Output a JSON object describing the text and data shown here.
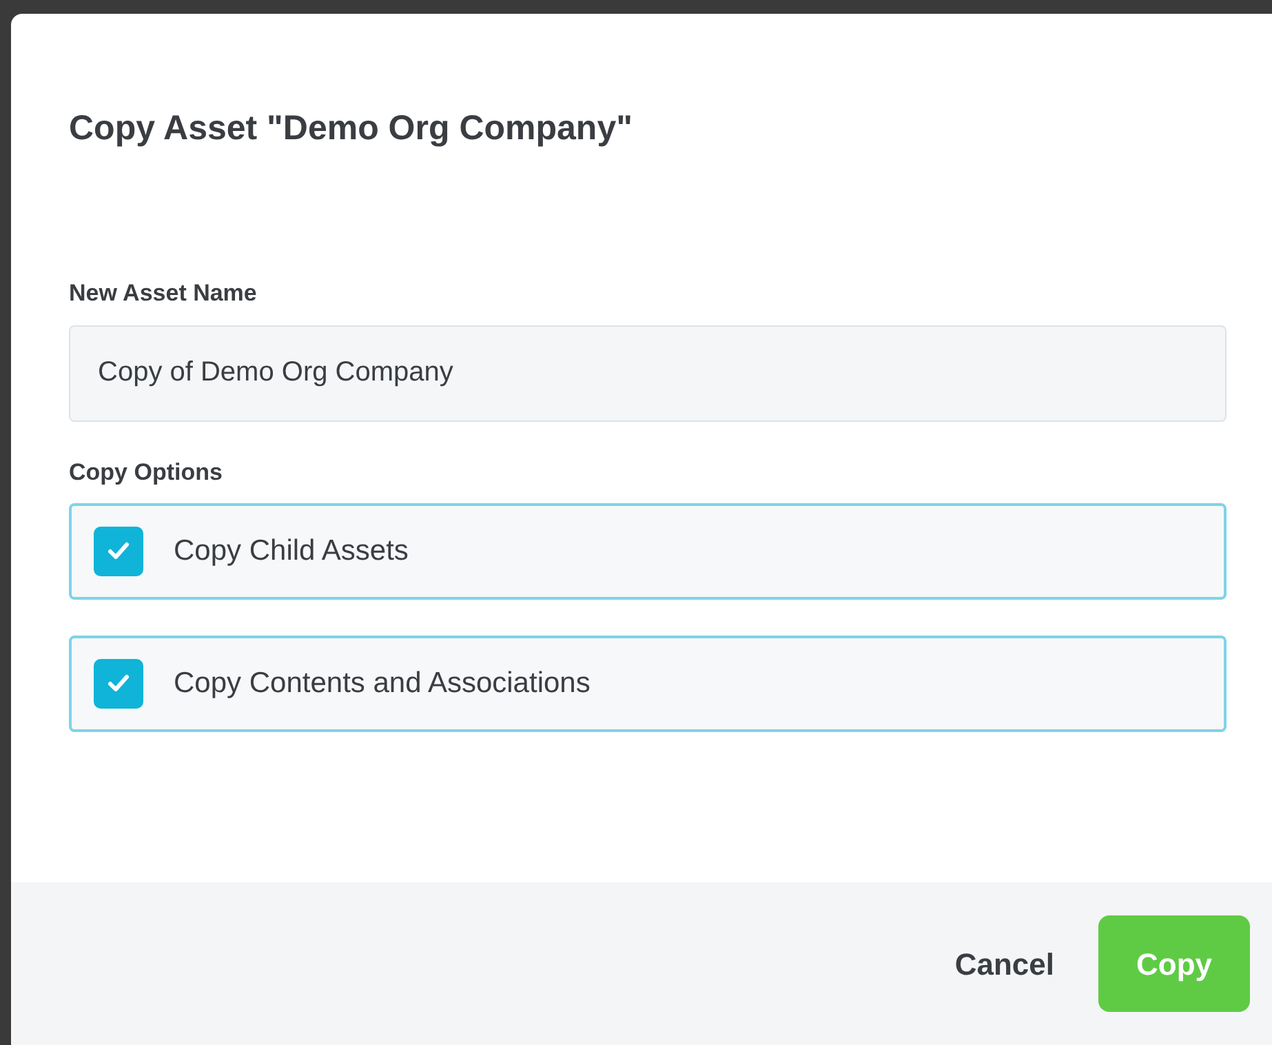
{
  "dialog": {
    "title": "Copy Asset \"Demo Org Company\"",
    "name_field": {
      "label": "New Asset Name",
      "value": "Copy of Demo Org Company"
    },
    "options_label": "Copy Options",
    "options": [
      {
        "label": "Copy Child Assets",
        "checked": true
      },
      {
        "label": "Copy Contents and Associations",
        "checked": true
      }
    ],
    "buttons": [
      {
        "label": "Cancel",
        "kind": "secondary"
      },
      {
        "label": "Copy",
        "kind": "primary"
      }
    ]
  }
}
